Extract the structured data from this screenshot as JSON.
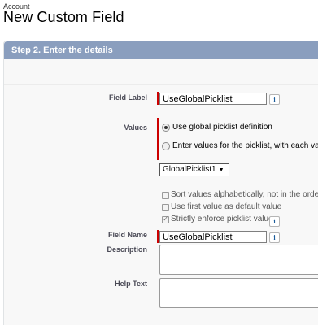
{
  "header": {
    "breadcrumb": "Account",
    "title": "New Custom Field"
  },
  "step": {
    "title": "Step 2. Enter the details"
  },
  "form": {
    "field_label": {
      "label": "Field Label",
      "value": "UseGlobalPicklist",
      "info": "i"
    },
    "values": {
      "label": "Values",
      "option_global": "Use global picklist definition",
      "option_custom": "Enter values for the picklist, with each value",
      "selected": "global"
    },
    "global_picklist": {
      "selected": "GlobalPicklist1",
      "arrow": "▼"
    },
    "checks": {
      "sort_alpha": "Sort values alphabetically, not in the order en",
      "first_default": "Use first value as default value",
      "strict": "Strictly enforce picklist values",
      "strict_info": "i"
    },
    "field_name": {
      "label": "Field Name",
      "value": "UseGlobalPicklist",
      "info": "i"
    },
    "description": {
      "label": "Description",
      "value": ""
    },
    "help_text": {
      "label": "Help Text",
      "value": ""
    }
  },
  "colors": {
    "header_bg": "#8a9ebe",
    "required": "#cc0000",
    "panel_bg": "#f8f8f8"
  }
}
